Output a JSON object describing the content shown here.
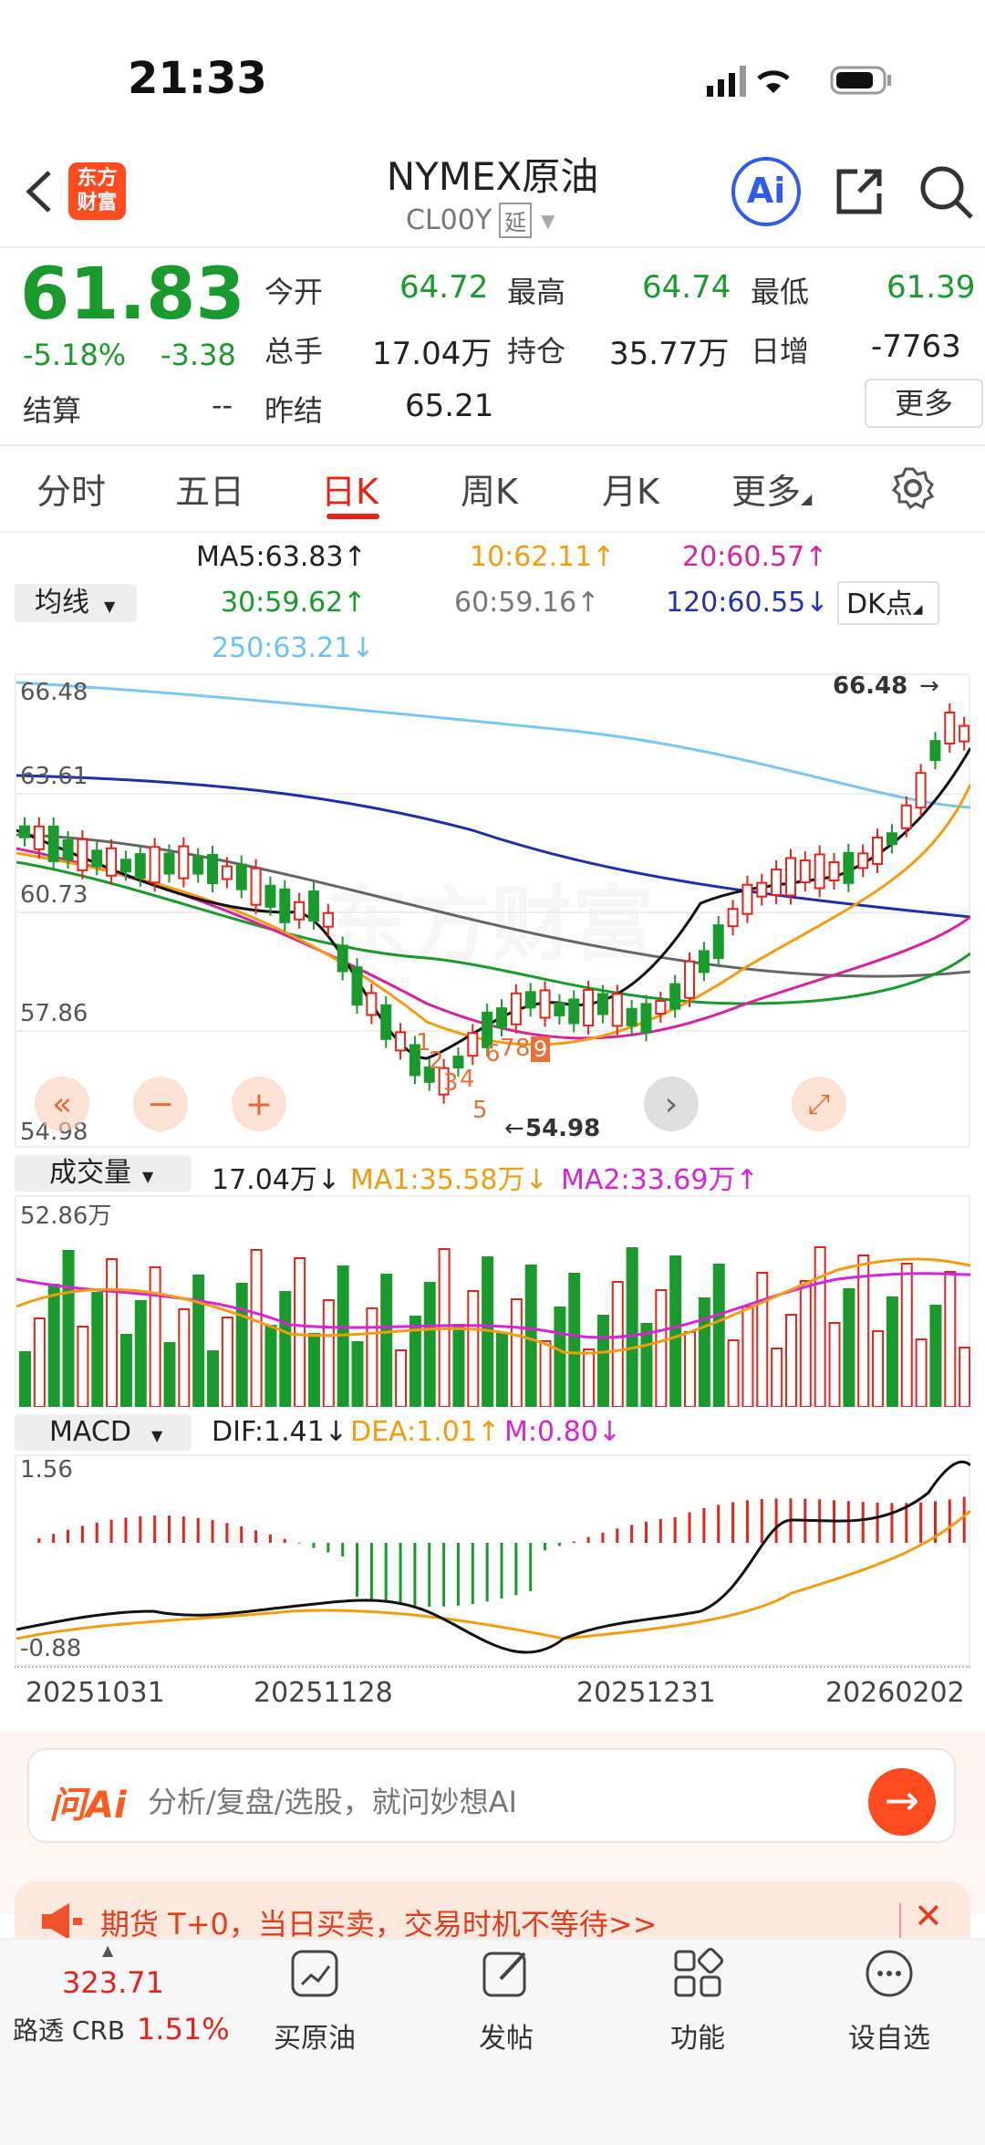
{
  "status_bar": {
    "time": "21:33"
  },
  "header": {
    "title": "NYMEX原油",
    "code": "CL00Y",
    "delay_badge": "延",
    "logo_text": "东方财富",
    "ai_label": "Ai"
  },
  "quote": {
    "price": "61.83",
    "change_pct": "-5.18%",
    "change": "-3.38",
    "open_label": "今开",
    "open": "64.72",
    "high_label": "最高",
    "high": "64.74",
    "low_label": "最低",
    "low": "61.39",
    "volume_label": "总手",
    "volume": "17.04万",
    "oi_label": "持仓",
    "oi": "35.77万",
    "daily_inc_label": "日增",
    "daily_inc": "-7763",
    "settle_label": "结算",
    "settle": "--",
    "prev_settle_label": "昨结",
    "prev_settle": "65.21",
    "more_button": "更多"
  },
  "tabs": [
    "分时",
    "五日",
    "日K",
    "周K",
    "月K",
    "更多"
  ],
  "ma": {
    "selector": "均线",
    "ma5": "MA5:63.83",
    "ma10": "10:62.11",
    "ma20": "20:60.57",
    "ma30": "30:59.62",
    "ma60": "60:59.16",
    "ma120": "120:60.55",
    "ma250": "250:63.21",
    "dk_button": "DK点"
  },
  "kline": {
    "y_labels": [
      "66.48",
      "63.61",
      "60.73",
      "57.86",
      "54.98"
    ],
    "high_marker": "66.48",
    "low_marker": "54.98",
    "watermark": "东方财富",
    "seq_labels": [
      "1",
      "2",
      "3",
      "4",
      "5",
      "6",
      "7",
      "8",
      "9"
    ]
  },
  "volume_panel": {
    "selector": "成交量",
    "value": "17.04万",
    "ma1": "MA1:35.58万",
    "ma2": "MA2:33.69万",
    "max_label": "52.86万"
  },
  "macd_panel": {
    "selector": "MACD",
    "dif": "DIF:1.41",
    "dea": "DEA:1.01",
    "m": "M:0.80",
    "max_label": "1.56",
    "min_label": "-0.88"
  },
  "dates": [
    "20251031",
    "20251128",
    "20251231",
    "20260202"
  ],
  "ask_ai": {
    "logo": "问Ai",
    "placeholder": "分析/复盘/选股，就问妙想AI"
  },
  "banner": {
    "text": "期货 T+0，当日买卖，交易时机不等待>>"
  },
  "bottom_nav": {
    "index_value": "323.71",
    "index_name": "路透 CRB",
    "index_change": "1.51%",
    "items": [
      "买原油",
      "发帖",
      "功能",
      "设自选"
    ]
  },
  "colors": {
    "up": "#e1251b",
    "down": "#1a9a2c",
    "accent": "#ff5a1f"
  }
}
